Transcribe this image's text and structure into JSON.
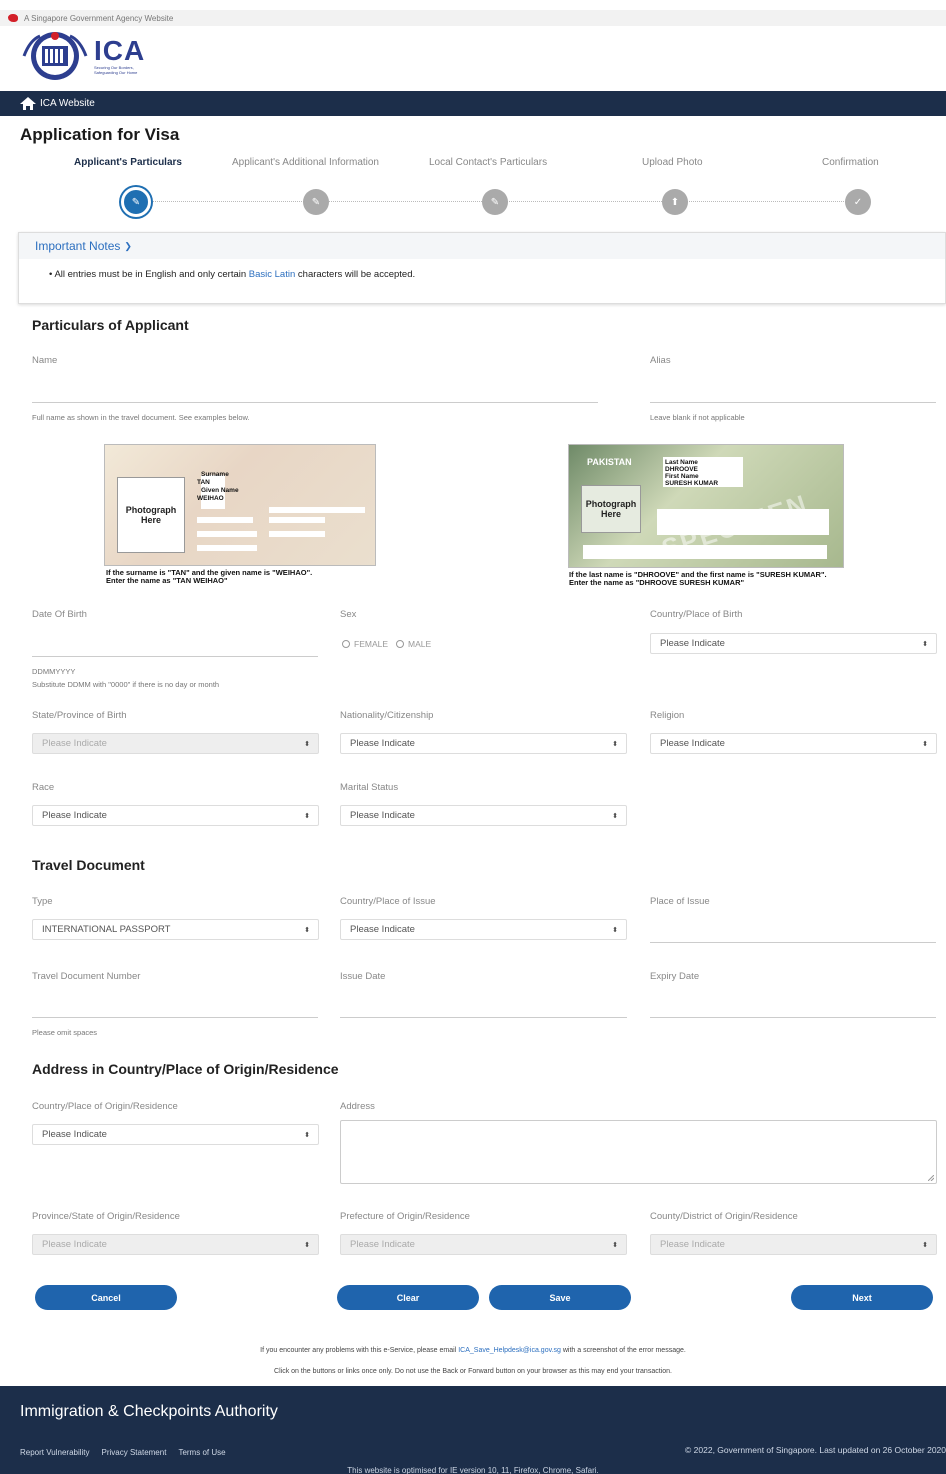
{
  "gov_banner": "A Singapore Government Agency Website",
  "brand": {
    "name": "ICA",
    "tagline": "Securing Our Borders, Safeguarding Our Home"
  },
  "nav": {
    "home_label": "ICA Website"
  },
  "page_title": "Application for Visa",
  "steps": [
    {
      "label": "Applicant's Particulars",
      "active": true
    },
    {
      "label": "Applicant's Additional Information",
      "active": false
    },
    {
      "label": "Local Contact's Particulars",
      "active": false
    },
    {
      "label": "Upload Photo",
      "active": false
    },
    {
      "label": "Confirmation",
      "active": false
    }
  ],
  "notes": {
    "title": "Important Notes",
    "text_before": "All entries must be in English and only certain",
    "link": "Basic Latin",
    "text_after": "characters will be accepted."
  },
  "particulars": {
    "title": "Particulars of Applicant",
    "name_label": "Name",
    "name_hint": "Full name as shown in the travel document. See examples below.",
    "alias_label": "Alias",
    "alias_hint": "Leave blank if not applicable",
    "example_sg": {
      "surname_label": "Surname",
      "surname": "TAN",
      "given_label": "Given Name",
      "given": "WEIHAO",
      "photo": "Photograph Here",
      "caption_1": "If the surname is \"TAN\" and the given name is \"WEIHAO\".",
      "caption_2": "Enter the name as \"TAN WEIHAO\""
    },
    "example_pk": {
      "country": "PAKISTAN",
      "last_label": "Last Name",
      "last": "DHROOVE",
      "first_label": "First Name",
      "first": "SURESH KUMAR",
      "photo": "Photograph Here",
      "specimen": "SPECIMEN",
      "caption_1": "If the last name is \"DHROOVE\" and the first name is \"SURESH KUMAR\".",
      "caption_2": "Enter the name as \"DHROOVE SURESH KUMAR\""
    },
    "dob_label": "Date Of Birth",
    "dob_format": "DDMMYYYY",
    "dob_hint": "Substitute DDMM with \"0000\" if there is no day or month",
    "sex_label": "Sex",
    "sex_female": "FEMALE",
    "sex_male": "MALE",
    "cob_label": "Country/Place of Birth",
    "cob_value": "Please Indicate",
    "state_label": "State/Province of Birth",
    "state_value": "Please Indicate",
    "nationality_label": "Nationality/Citizenship",
    "nationality_value": "Please Indicate",
    "religion_label": "Religion",
    "religion_value": "Please Indicate",
    "race_label": "Race",
    "race_value": "Please Indicate",
    "marital_label": "Marital Status",
    "marital_value": "Please Indicate"
  },
  "travel": {
    "title": "Travel Document",
    "type_label": "Type",
    "type_value": "INTERNATIONAL PASSPORT",
    "coi_label": "Country/Place of Issue",
    "coi_value": "Please Indicate",
    "poi_label": "Place of Issue",
    "number_label": "Travel Document Number",
    "number_hint": "Please omit spaces",
    "issue_label": "Issue Date",
    "expiry_label": "Expiry Date"
  },
  "address": {
    "title": "Address in Country/Place of Origin/Residence",
    "country_label": "Country/Place of Origin/Residence",
    "country_value": "Please Indicate",
    "address_label": "Address",
    "province_label": "Province/State of Origin/Residence",
    "province_value": "Please Indicate",
    "prefecture_label": "Prefecture of Origin/Residence",
    "prefecture_value": "Please Indicate",
    "county_label": "County/District of Origin/Residence",
    "county_value": "Please Indicate"
  },
  "buttons": {
    "cancel": "Cancel",
    "clear": "Clear",
    "save": "Save",
    "next": "Next"
  },
  "help": {
    "line1_before": "If you encounter any problems with this e-Service, please email",
    "email": "ICA_Save_Helpdesk@ica.gov.sg",
    "line1_after": "with a screenshot of the error message.",
    "line2": "Click on the buttons or links once only. Do not use the Back or Forward button on your browser as this may end your transaction."
  },
  "footer": {
    "title": "Immigration & Checkpoints Authority",
    "links": [
      "Report Vulnerability",
      "Privacy Statement",
      "Terms of Use"
    ],
    "copyright": "© 2022, Government of Singapore. Last updated on 26 October 2020",
    "optimised": "This website is optimised for IE version 10, 11, Firefox, Chrome, Safari."
  },
  "colors": {
    "navy": "#1c2e4a",
    "button_blue": "#1f64ad",
    "link_blue": "#2c6fbf",
    "brand_blue": "#2d3e8f",
    "lion_red": "#d32029"
  },
  "icons": [
    "lion-head-icon",
    "ica-crest-icon",
    "home-icon",
    "pencil-icon",
    "upload-icon",
    "check-icon",
    "chevron-down-icon",
    "sort-arrows-icon",
    "resize-grip-icon"
  ]
}
